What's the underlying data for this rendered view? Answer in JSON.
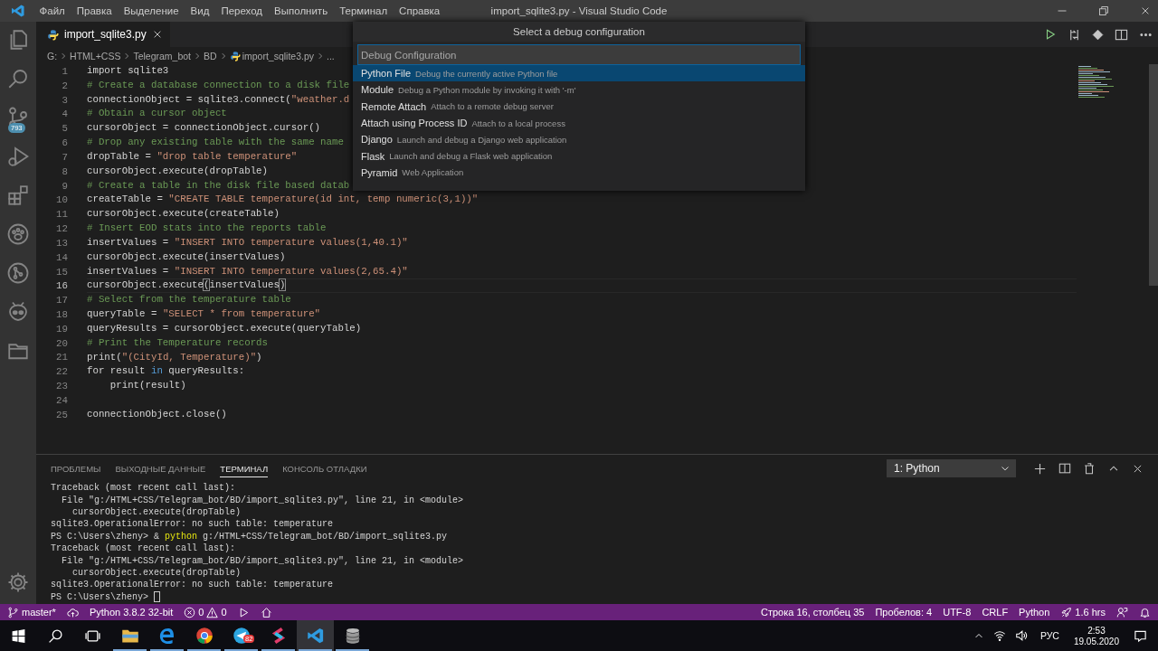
{
  "title_bar": {
    "menu": [
      "Файл",
      "Правка",
      "Выделение",
      "Вид",
      "Переход",
      "Выполнить",
      "Терминал",
      "Справка"
    ],
    "title": "import_sqlite3.py - Visual Studio Code"
  },
  "activity_bar": {
    "source_control_badge": "793"
  },
  "tabs": [
    {
      "label": "import_sqlite3.py",
      "selected": true
    }
  ],
  "breadcrumb": [
    "G:",
    "HTML+CSS",
    "Telegram_bot",
    "BD",
    "import_sqlite3.py",
    "..."
  ],
  "editor": {
    "lines": [
      {
        "number": "1",
        "current": false,
        "tokens": [
          {
            "kind": "plain",
            "text": "import sqlite3"
          }
        ]
      },
      {
        "number": "2",
        "current": false,
        "tokens": [
          {
            "kind": "comment",
            "text": "# Create a database connection to a disk file"
          }
        ]
      },
      {
        "number": "3",
        "current": false,
        "tokens": [
          {
            "kind": "plain",
            "text": "connectionObject = sqlite3.connect("
          },
          {
            "kind": "string",
            "text": "\"weather.d"
          }
        ]
      },
      {
        "number": "4",
        "current": false,
        "tokens": [
          {
            "kind": "comment",
            "text": "# Obtain a cursor object"
          }
        ]
      },
      {
        "number": "5",
        "current": false,
        "tokens": [
          {
            "kind": "plain",
            "text": "cursorObject = connectionObject.cursor()"
          }
        ]
      },
      {
        "number": "6",
        "current": false,
        "tokens": [
          {
            "kind": "comment",
            "text": "# Drop any existing table with the same name"
          }
        ]
      },
      {
        "number": "7",
        "current": false,
        "tokens": [
          {
            "kind": "plain",
            "text": "dropTable = "
          },
          {
            "kind": "string",
            "text": "\"drop table temperature\""
          }
        ]
      },
      {
        "number": "8",
        "current": false,
        "tokens": [
          {
            "kind": "plain",
            "text": "cursorObject.execute(dropTable)"
          }
        ]
      },
      {
        "number": "9",
        "current": false,
        "tokens": [
          {
            "kind": "comment",
            "text": "# Create a table in the disk file based datab"
          }
        ]
      },
      {
        "number": "10",
        "current": false,
        "tokens": [
          {
            "kind": "plain",
            "text": "createTable = "
          },
          {
            "kind": "string",
            "text": "\"CREATE TABLE temperature(id int, temp numeric(3,1))\""
          }
        ]
      },
      {
        "number": "11",
        "current": false,
        "tokens": [
          {
            "kind": "plain",
            "text": "cursorObject.execute(createTable)"
          }
        ]
      },
      {
        "number": "12",
        "current": false,
        "tokens": [
          {
            "kind": "comment",
            "text": "# Insert EOD stats into the reports table"
          }
        ]
      },
      {
        "number": "13",
        "current": false,
        "tokens": [
          {
            "kind": "plain",
            "text": "insertValues = "
          },
          {
            "kind": "string",
            "text": "\"INSERT INTO temperature values(1,40.1)\""
          }
        ]
      },
      {
        "number": "14",
        "current": false,
        "tokens": [
          {
            "kind": "plain",
            "text": "cursorObject.execute(insertValues)"
          }
        ]
      },
      {
        "number": "15",
        "current": false,
        "tokens": [
          {
            "kind": "plain",
            "text": "insertValues = "
          },
          {
            "kind": "string",
            "text": "\"INSERT INTO temperature values(2,65.4)\""
          }
        ]
      },
      {
        "number": "16",
        "current": true,
        "tokens": [
          {
            "kind": "plain",
            "text": "cursorObject.execute"
          },
          {
            "kind": "bracket",
            "text": "("
          },
          {
            "kind": "plain",
            "text": "insertValues"
          },
          {
            "kind": "bracket",
            "text": ")"
          }
        ]
      },
      {
        "number": "17",
        "current": false,
        "tokens": [
          {
            "kind": "comment",
            "text": "# Select from the temperature table"
          }
        ]
      },
      {
        "number": "18",
        "current": false,
        "tokens": [
          {
            "kind": "plain",
            "text": "queryTable = "
          },
          {
            "kind": "string",
            "text": "\"SELECT * from temperature\""
          }
        ]
      },
      {
        "number": "19",
        "current": false,
        "tokens": [
          {
            "kind": "plain",
            "text": "queryResults = cursorObject.execute(queryTable)"
          }
        ]
      },
      {
        "number": "20",
        "current": false,
        "tokens": [
          {
            "kind": "comment",
            "text": "# Print the Temperature records"
          }
        ]
      },
      {
        "number": "21",
        "current": false,
        "tokens": [
          {
            "kind": "plain",
            "text": "print("
          },
          {
            "kind": "string",
            "text": "\"(CityId, Temperature)\""
          },
          {
            "kind": "plain",
            "text": ")"
          }
        ]
      },
      {
        "number": "22",
        "current": false,
        "tokens": [
          {
            "kind": "plain",
            "text": "for result "
          },
          {
            "kind": "keyword",
            "text": "in"
          },
          {
            "kind": "plain",
            "text": " queryResults:"
          }
        ]
      },
      {
        "number": "23",
        "current": false,
        "tokens": [
          {
            "kind": "plain",
            "text": "    print(result)"
          }
        ]
      },
      {
        "number": "24",
        "current": false
      },
      {
        "number": "25",
        "current": false,
        "tokens": [
          {
            "kind": "plain",
            "text": "connectionObject.close()"
          }
        ]
      }
    ]
  },
  "quick_pick": {
    "title": "Select a debug configuration",
    "input": {
      "placeholder": "Debug Configuration"
    },
    "items": [
      {
        "label": "Python File",
        "description": "Debug the currently active Python file",
        "selected": true
      },
      {
        "label": "Module",
        "description": "Debug a Python module by invoking it with '-m'",
        "selected": false
      },
      {
        "label": "Remote Attach",
        "description": "Attach to a remote debug server",
        "selected": false
      },
      {
        "label": "Attach using Process ID",
        "description": "Attach to a local process",
        "selected": false
      },
      {
        "label": "Django",
        "description": "Launch and debug a Django web application",
        "selected": false
      },
      {
        "label": "Flask",
        "description": "Launch and debug a Flask web application",
        "selected": false
      },
      {
        "label": "Pyramid",
        "description": "Web Application",
        "selected": false
      }
    ]
  },
  "panel": {
    "tabs": [
      {
        "label": "ПРОБЛЕМЫ",
        "selected": false
      },
      {
        "label": "ВЫХОДНЫЕ ДАННЫЕ",
        "selected": false
      },
      {
        "label": "ТЕРМИНАЛ",
        "selected": true
      },
      {
        "label": "КОНСОЛЬ ОТЛАДКИ",
        "selected": false
      }
    ],
    "terminal_select": "1: Python",
    "terminal_lines": [
      [
        {
          "kind": "plain",
          "text": "Traceback (most recent call last):"
        }
      ],
      [
        {
          "kind": "plain",
          "text": "  File \"g:/HTML+CSS/Telegram_bot/BD/import_sqlite3.py\", line 21, in <module>"
        }
      ],
      [
        {
          "kind": "plain",
          "text": "    cursorObject.execute(dropTable)"
        }
      ],
      [
        {
          "kind": "plain",
          "text": "sqlite3.OperationalError: no such table: temperature"
        }
      ],
      [
        {
          "kind": "plain",
          "text": "PS C:\\Users\\zheny> & "
        },
        {
          "kind": "command",
          "text": "python"
        },
        {
          "kind": "plain",
          "text": " g:/HTML+CSS/Telegram_bot/BD/import_sqlite3.py"
        }
      ],
      [
        {
          "kind": "plain",
          "text": "Traceback (most recent call last):"
        }
      ],
      [
        {
          "kind": "plain",
          "text": "  File \"g:/HTML+CSS/Telegram_bot/BD/import_sqlite3.py\", line 21, in <module>"
        }
      ],
      [
        {
          "kind": "plain",
          "text": "    cursorObject.execute(dropTable)"
        }
      ],
      [
        {
          "kind": "plain",
          "text": "sqlite3.OperationalError: no such table: temperature"
        }
      ],
      [
        {
          "kind": "plain",
          "text": "PS C:\\Users\\zheny> "
        }
      ]
    ]
  },
  "status_bar": {
    "branch": "master*",
    "interpreter": "Python 3.8.2 32-bit",
    "errors": "0",
    "warnings": "0",
    "position": "Строка 16, столбец 35",
    "indent": "Пробелов: 4",
    "encoding": "UTF-8",
    "eol": "CRLF",
    "language": "Python",
    "time_tracked": "1.6 hrs"
  },
  "taskbar": {
    "apps": [
      {
        "active": false
      },
      {
        "active": false
      },
      {
        "active": false,
        "badge": "82"
      },
      {
        "active": false
      },
      {
        "active": true
      },
      {
        "active": false
      }
    ],
    "language": "РУС",
    "time": "2:53",
    "date": "19.05.2020"
  }
}
